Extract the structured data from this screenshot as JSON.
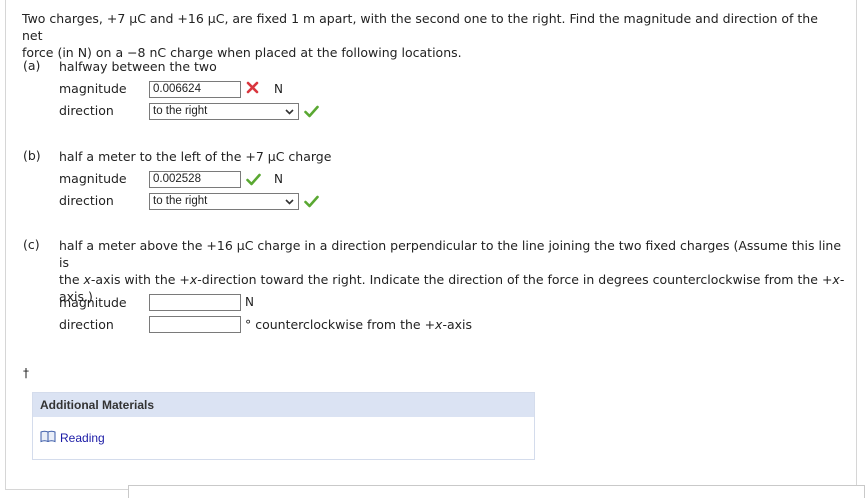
{
  "question": {
    "line1": "Two charges, +7 μC and +16 μC, are fixed 1 m apart, with the second one to the right. Find the magnitude and direction of the net",
    "line2": "force (in N) on a −8 nC charge when placed at the following locations."
  },
  "part_a": {
    "label": "(a)",
    "text": "halfway between the two",
    "magnitude_label": "magnitude",
    "magnitude_value": "0.006624",
    "magnitude_unit": "N",
    "magnitude_status": "incorrect",
    "direction_label": "direction",
    "direction_value": "to the right",
    "direction_status": "correct"
  },
  "part_b": {
    "label": "(b)",
    "text": "half a meter to the left of the +7 μC charge",
    "magnitude_label": "magnitude",
    "magnitude_value": "0.002528",
    "magnitude_unit": "N",
    "magnitude_status": "correct",
    "direction_label": "direction",
    "direction_value": "to the right",
    "direction_status": "correct"
  },
  "part_c": {
    "label": "(c)",
    "text_line1": "half a meter above the +16 μC charge in a direction perpendicular to the line joining the two fixed charges (Assume this line is",
    "text_line2_pre": "the ",
    "text_line2_x1": "x",
    "text_line2_mid": "-axis with the +",
    "text_line2_x2": "x",
    "text_line2_post": "-direction toward the right. Indicate the direction of the force in degrees counterclockwise from the +",
    "text_line2_x3": "x",
    "text_line2_end": "-",
    "text_line3": "axis.)",
    "magnitude_label": "magnitude",
    "magnitude_value": "",
    "magnitude_unit": "N",
    "direction_label": "direction",
    "direction_value": "",
    "direction_unit_pre": "° counterclockwise from the +",
    "direction_unit_x": "x",
    "direction_unit_post": "-axis"
  },
  "dagger": "†",
  "additional_materials": {
    "title": "Additional Materials",
    "link_label": "Reading",
    "link_icon": "book-icon"
  },
  "colors": {
    "correct": "#5aa832",
    "incorrect": "#d9363e",
    "link": "#1a1aa6",
    "panel_header": "#dbe3f3"
  }
}
